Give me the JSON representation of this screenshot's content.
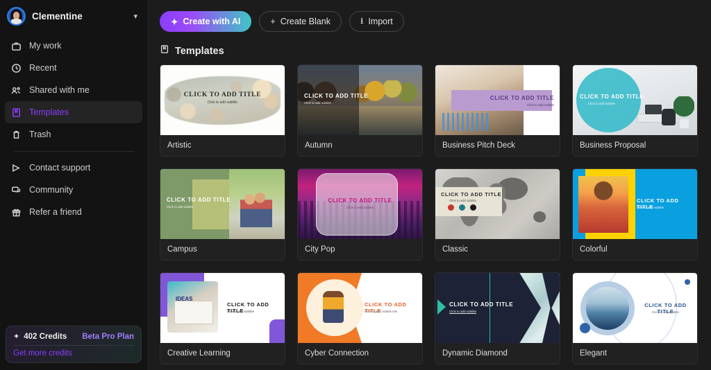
{
  "sidebar": {
    "user": {
      "name": "Clementine",
      "avatar_icon": "user-avatar",
      "chevron_icon": "chevron-down-icon"
    },
    "items": [
      {
        "label": "My work",
        "icon": "briefcase-icon",
        "active": false
      },
      {
        "label": "Recent",
        "icon": "clock-icon",
        "active": false
      },
      {
        "label": "Shared with me",
        "icon": "people-icon",
        "active": false
      },
      {
        "label": "Templates",
        "icon": "template-icon",
        "active": true
      },
      {
        "label": "Trash",
        "icon": "trash-icon",
        "active": false
      }
    ],
    "secondary_items": [
      {
        "label": "Contact support",
        "icon": "send-icon"
      },
      {
        "label": "Community",
        "icon": "chat-icon"
      },
      {
        "label": "Refer a friend",
        "icon": "gift-icon"
      }
    ],
    "credits": {
      "amount_label": "402 Credits",
      "plan_label": "Beta Pro Plan",
      "link_label": "Get more credits",
      "sparkle_icon": "sparkle-icon"
    }
  },
  "colors": {
    "accent": "#8b3dff",
    "accent_gradient_end": "#3fc6c6",
    "sidebar_bg": "#131313",
    "main_bg": "#1c1c1c",
    "plan_text": "#a07cff"
  },
  "toolbar": {
    "create_ai_label": "Create with AI",
    "create_ai_icon": "sparkle-icon",
    "create_blank_label": "Create Blank",
    "create_blank_icon": "plus-icon",
    "import_label": "Import",
    "import_icon": "download-icon"
  },
  "section": {
    "title": "Templates",
    "icon": "template-icon"
  },
  "templates": [
    {
      "name": "Artistic",
      "title": "CLICK TO ADD TITLE",
      "subtitle": "Click to add subtitle"
    },
    {
      "name": "Autumn",
      "title": "CLICK TO ADD TITLE",
      "subtitle": "Click to add subtitle"
    },
    {
      "name": "Business Pitch Deck",
      "title": "CLICK TO ADD TITLE",
      "subtitle": "Click to add subtitle"
    },
    {
      "name": "Business Proposal",
      "title": "CLICK TO ADD TITLE",
      "subtitle": "Click to add subtitle"
    },
    {
      "name": "Campus",
      "title": "CLICK TO ADD TITLE",
      "subtitle": "Click to add subtitle"
    },
    {
      "name": "City Pop",
      "title": "CLICK TO ADD TITLE",
      "subtitle": "Click to add subtitle"
    },
    {
      "name": "Classic",
      "title": "CLICK TO ADD TITLE",
      "subtitle": "Click to add subtitle"
    },
    {
      "name": "Colorful",
      "title": "CLICK TO ADD TITLE",
      "subtitle": "Click to add subtitle"
    },
    {
      "name": "Creative Learning",
      "title": "CLICK TO ADD TITLE",
      "subtitle": "Click to add subtitle"
    },
    {
      "name": "Cyber Connection",
      "title": "CLICK TO ADD TITLE",
      "subtitle": "Click to add subtitle title"
    },
    {
      "name": "Dynamic Diamond",
      "title": "CLICK TO ADD TITLE",
      "subtitle": "Click to add subtitle"
    },
    {
      "name": "Elegant",
      "title": "CLICK TO ADD TITLE",
      "subtitle": "Click to add subtitle"
    }
  ],
  "classic_chart": {
    "type": "pie",
    "title": "",
    "series": [
      {
        "name": "segment-1",
        "color": "#c0392b"
      },
      {
        "name": "segment-2",
        "color": "#1f7a8c"
      },
      {
        "name": "segment-3",
        "color": "#1a1a1a"
      }
    ]
  }
}
